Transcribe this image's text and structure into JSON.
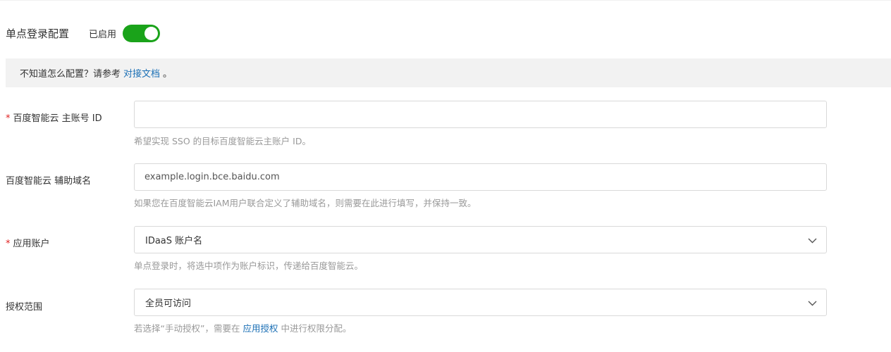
{
  "header": {
    "title": "单点登录配置",
    "status_label": "已启用",
    "toggle_on_color": "#1aa31a"
  },
  "notice": {
    "text": "不知道怎么配置？请参考",
    "link_text": "对接文档",
    "suffix": "。"
  },
  "colors": {
    "link": "#1a6fb5",
    "required": "#e02020"
  },
  "form": {
    "account_id": {
      "required_mark": "*",
      "label": "百度智能云 主账号 ID",
      "value": "",
      "hint": "希望实现 SSO 的目标百度智能云主账户 ID。"
    },
    "aux_domain": {
      "label": "百度智能云 辅助域名",
      "placeholder": "example.login.bce.baidu.com",
      "hint": "如果您在百度智能云IAM用户联合定义了辅助域名，则需要在此进行填写，并保持一致。"
    },
    "app_account": {
      "required_mark": "*",
      "label": "应用账户",
      "selected": "IDaaS 账户名",
      "icon": "chevron-down-icon",
      "hint": "单点登录时，将选中项作为账户标识，传递给百度智能云。"
    },
    "auth_scope": {
      "label": "授权范围",
      "selected": "全员可访问",
      "icon": "chevron-down-icon",
      "hint_prefix": "若选择“手动授权”，需要在",
      "hint_link": "应用授权",
      "hint_suffix": "中进行权限分配。"
    }
  }
}
